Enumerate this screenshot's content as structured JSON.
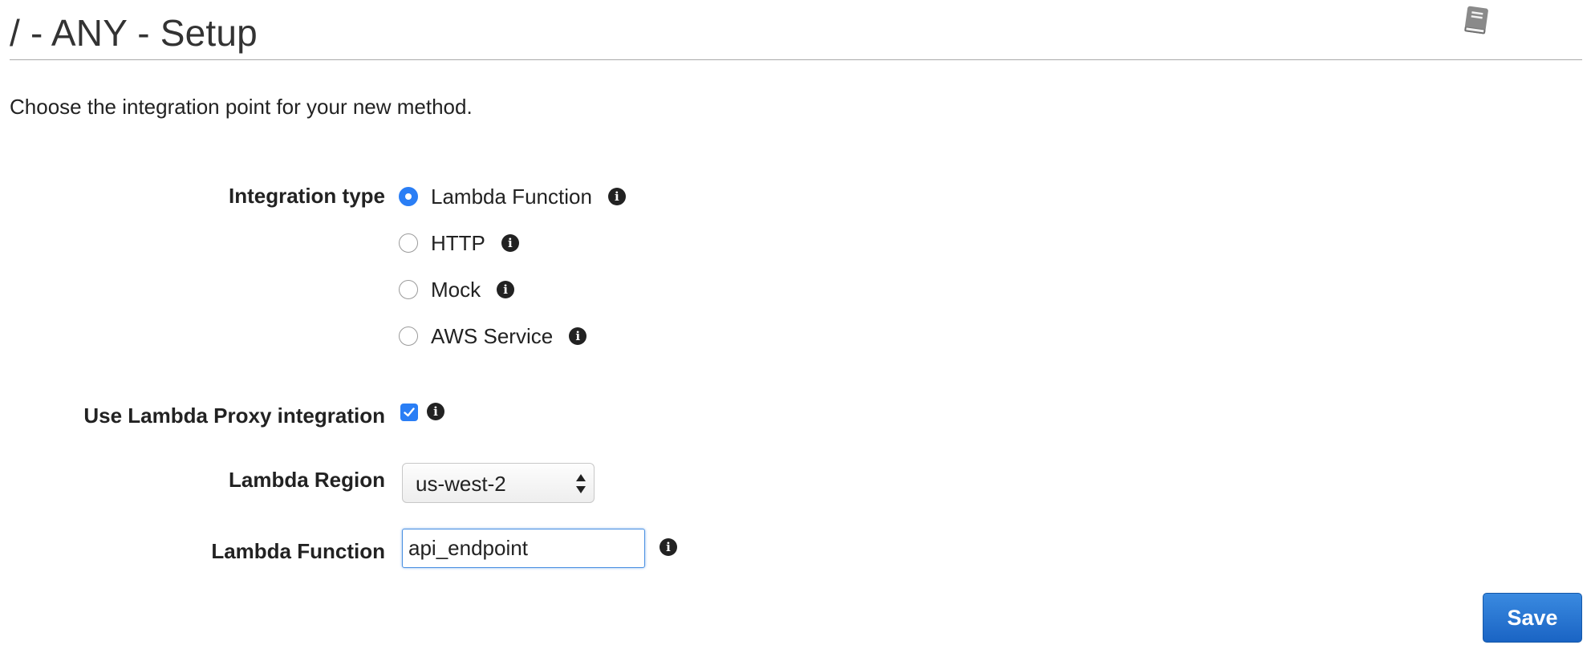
{
  "header": {
    "title": "/ - ANY - Setup",
    "help_icon": "book-icon"
  },
  "intro": "Choose the integration point for your new method.",
  "integration_type": {
    "label": "Integration type",
    "selected": "Lambda Function",
    "options": [
      {
        "label": "Lambda Function",
        "checked": true
      },
      {
        "label": "HTTP",
        "checked": false
      },
      {
        "label": "Mock",
        "checked": false
      },
      {
        "label": "AWS Service",
        "checked": false
      }
    ]
  },
  "proxy": {
    "label": "Use Lambda Proxy integration",
    "checked": true
  },
  "region": {
    "label": "Lambda Region",
    "value": "us-west-2"
  },
  "function": {
    "label": "Lambda Function",
    "value": "api_endpoint"
  },
  "info_icon": "info-icon",
  "actions": {
    "save_label": "Save"
  },
  "colors": {
    "accent": "#2a7ef5",
    "button": "#1a64c4",
    "text": "#222222"
  }
}
